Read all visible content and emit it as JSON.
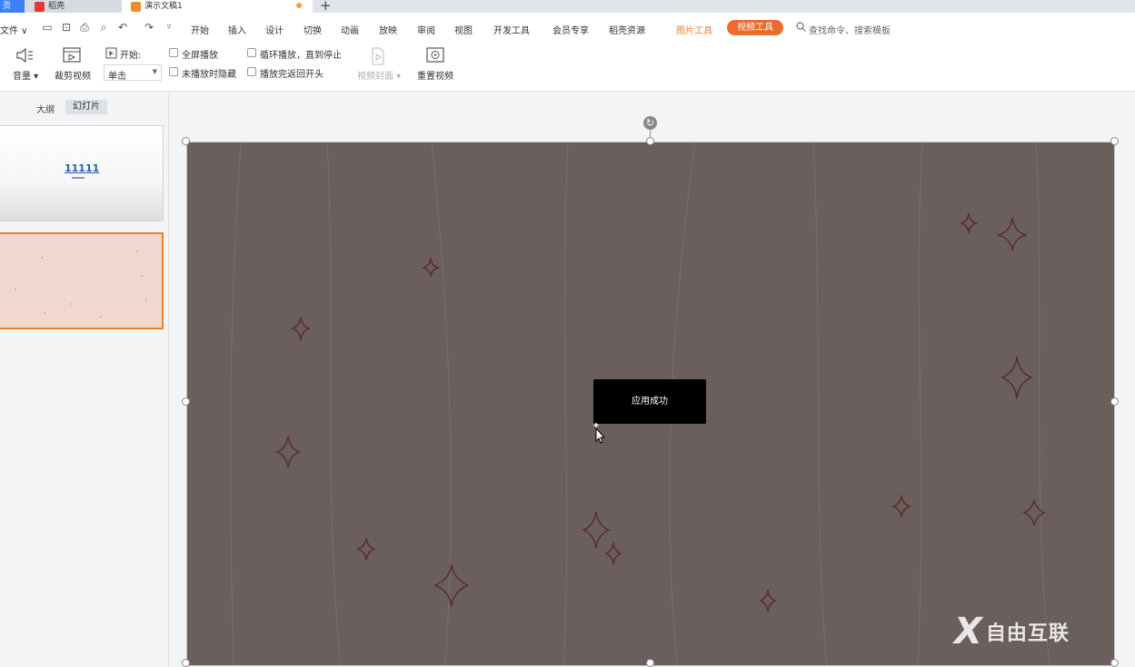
{
  "tabs": {
    "home": "页",
    "docer": "稻壳",
    "doc": "演示文稿1",
    "new_tab": "+"
  },
  "menu": {
    "file": "文件",
    "items": [
      "开始",
      "插入",
      "设计",
      "切换",
      "动画",
      "放映",
      "审阅",
      "视图",
      "开发工具",
      "会员专享",
      "稻壳资源"
    ],
    "picture_tools": "图片工具",
    "video_tools": "视频工具",
    "search_placeholder": "查找命令、搜索模板"
  },
  "ribbon": {
    "volume": "音量",
    "trim_video": "裁剪视频",
    "start_label": "开始:",
    "start_value": "单击",
    "fullscreen": "全屏播放",
    "hide_not_playing": "未播放时隐藏",
    "loop": "循环播放，直到停止",
    "rewind": "播放完返回开头",
    "video_cover": "视频封面",
    "reset_video": "重置视频"
  },
  "left_panel": {
    "outline_tab": "大纲",
    "slides_tab": "幻灯片",
    "thumb1_title": "11111"
  },
  "toast": {
    "message": "应用成功"
  },
  "watermark": {
    "text": "自由互联"
  },
  "colors": {
    "accent": "#ec6a2c",
    "slide_bg": "#6b5f5d",
    "thumb_selected_border": "#e8832a"
  }
}
